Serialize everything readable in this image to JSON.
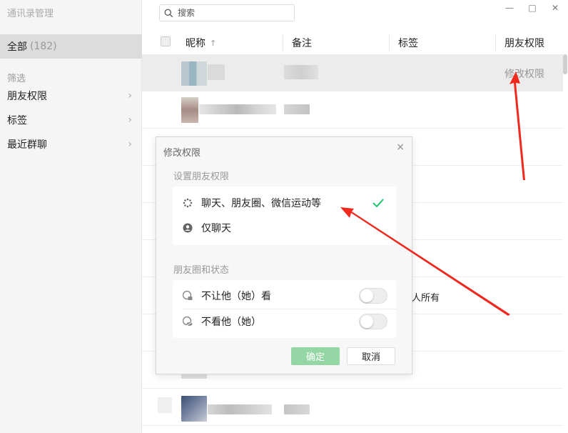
{
  "app": {
    "title": "通讯录管理"
  },
  "sidebar": {
    "all_label": "全部",
    "all_count": "(182)",
    "filter_label": "筛选",
    "items": [
      {
        "label": "朋友权限",
        "icon": "chevron-right-icon"
      },
      {
        "label": "标签",
        "icon": "chevron-right-icon"
      },
      {
        "label": "最近群聊",
        "icon": "chevron-right-icon"
      }
    ]
  },
  "search": {
    "placeholder": "搜索",
    "icon": "search-icon"
  },
  "window": {
    "minimize": "—",
    "maximize": "□",
    "close": "✕"
  },
  "table": {
    "headers": {
      "nickname": "昵称",
      "nickname_sort": "↑",
      "remark": "备注",
      "tag": "标签",
      "permission": "朋友权限"
    },
    "hover_row_action": "修改权限",
    "partial_cell": "人所有"
  },
  "modal": {
    "title": "修改权限",
    "close": "×",
    "section1_label": "设置朋友权限",
    "options": [
      {
        "label": "聊天、朋友圈、微信运动等",
        "selected": true
      },
      {
        "label": "仅聊天",
        "selected": false
      }
    ],
    "section2_label": "朋友圈和状态",
    "toggles": [
      {
        "label": "不让他（她）看",
        "on": false
      },
      {
        "label": "不看他（她）",
        "on": false
      }
    ],
    "confirm": "确定",
    "cancel": "取消"
  },
  "colors": {
    "accent_green": "#07c160",
    "confirm_disabled": "#95d7a4",
    "annotation_red": "#f0281e"
  }
}
